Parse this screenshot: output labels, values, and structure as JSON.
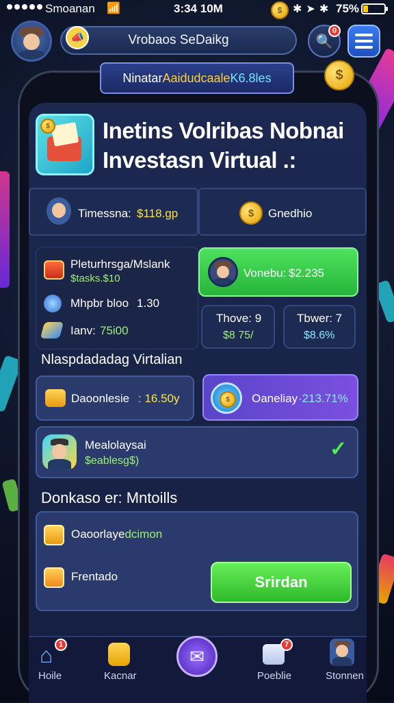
{
  "status_bar": {
    "carrier": "Smoanan",
    "time": "3:34 10M",
    "battery_pct": "75%"
  },
  "top_bar": {
    "search_text": "Vrobaos SeDaikg",
    "notification_badge": "0"
  },
  "banner": {
    "part1": "Ninatar ",
    "part2": "Aaidudcaale ",
    "part3": "K6.8les"
  },
  "header": {
    "title_line1": "Inetins Volribas Nobnai",
    "title_line2": "Investasn Virtual .:"
  },
  "tabs": {
    "left_label": "Timessna:",
    "left_value": "$118.gp",
    "right_label": "Gnedhio"
  },
  "portfolio": {
    "items": [
      {
        "label": "Pleturhrsga/Mslank",
        "value": "$tasks.$10"
      },
      {
        "label": "Mhpbr bloo",
        "value": "1.30"
      },
      {
        "label": "Ianv:",
        "value": "75i00"
      }
    ]
  },
  "volume_card": {
    "label": "Vonebu:",
    "value": "$2.235"
  },
  "stats": [
    {
      "label": "Thove: 9",
      "value": "$8 75/"
    },
    {
      "label": "Tbwer: 7",
      "value": "$8.6%"
    }
  ],
  "section1_title": "Nlaspdadadag Virtalian",
  "cards_row": {
    "left_label": "Daoonlesie",
    "left_value": ": 16.50y",
    "right_label": "Oaneliay",
    "right_value": "·213.71%"
  },
  "member_card": {
    "name": "Mealolaysai",
    "value": "$eablesg$)"
  },
  "section2_title": "Donkaso er: Mntoills",
  "bottom_panel": {
    "row1": "Oaoorlaye",
    "row1_suffix": "dcimon",
    "row2": "Frentado",
    "button": "Srirdan"
  },
  "nav": {
    "items": [
      {
        "label": "Hoile",
        "badge": "1"
      },
      {
        "label": "Kacnar"
      },
      {
        "label": ""
      },
      {
        "label": "Poeblie",
        "badge": "7"
      },
      {
        "label": "Stonnen"
      }
    ]
  },
  "colors": {
    "accent_green": "#3fd54d",
    "accent_purple": "#6a4fd8",
    "panel": "#1d2a52",
    "coin": "#f5b90f"
  }
}
